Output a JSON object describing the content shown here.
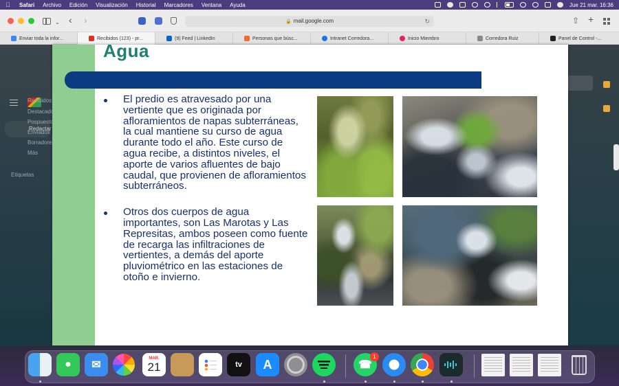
{
  "menubar": {
    "apple": "",
    "items": [
      "Safari",
      "Archivo",
      "Edición",
      "Visualización",
      "Historial",
      "Marcadores",
      "Ventana",
      "Ayuda"
    ],
    "datetime": "Jue 21 mar.  16:36"
  },
  "toolbar": {
    "url": "mail.google.com"
  },
  "tabs": [
    {
      "label": "Enviar toda la infor...",
      "favicon_color": "#4285f4"
    },
    {
      "label": "Recibidos (123) - pr...",
      "favicon_color": "#d93025"
    },
    {
      "label": "(9) Feed | LinkedIn",
      "favicon_color": "#0a66c2"
    },
    {
      "label": "Personas que búsc...",
      "favicon_color": "#f06a35"
    },
    {
      "label": "Intranet Corredora...",
      "favicon_color": "#1a73e8"
    },
    {
      "label": "Inicio Miembro",
      "favicon_color": "#e0245e"
    },
    {
      "label": "Corredora Ruiz",
      "favicon_color": "#888888"
    },
    {
      "label": "Panel de Control -...",
      "favicon_color": "#222222"
    }
  ],
  "gmail": {
    "compose_label": "Redactar",
    "nav": [
      "Recibidos",
      "Destacados",
      "Pospuestos",
      "Enviados",
      "Borradores",
      "Más"
    ],
    "section": "Etiquetas"
  },
  "slide": {
    "title": "Agua",
    "bullets": [
      "El predio es atravesado por una vertiente que es originada por afloramientos de napas subterráneas, la cual mantiene su curso de agua durante todo el año. Este curso de agua recibe, a distintos niveles, el aporte de varios afluentes de bajo caudal, que provienen de afloramientos subterráneos.",
      "Otros dos cuerpos de agua importantes, son Las Marotas y Las Represitas, ambos poseen como fuente de recarga las infiltraciones de vertientes, a demás del aporte pluviométrico en las estaciones de otoño e invierno."
    ],
    "colors": {
      "title": "#1f7f73",
      "bar": "#0c3b82",
      "stripe": "#8fce90",
      "text": "#17306f"
    }
  },
  "dock": {
    "calendar_month": "MAR.",
    "calendar_day": "21",
    "tv_label": "tv",
    "whatsapp_badge": "1",
    "apps": [
      "finder",
      "messages",
      "mail",
      "photos",
      "calendar",
      "contacts",
      "reminders",
      "apple-tv",
      "app-store",
      "system-settings",
      "spotify",
      "whatsapp",
      "safari",
      "chrome",
      "audio-app",
      "trash"
    ]
  }
}
